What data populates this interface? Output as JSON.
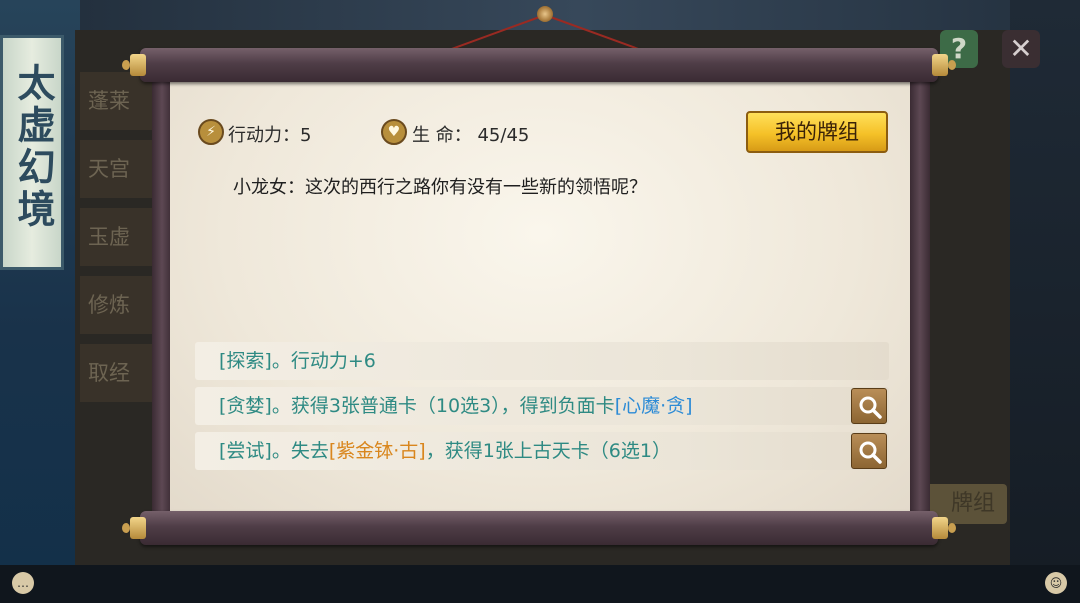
{
  "background": {
    "banner_title": "太虚幻境",
    "side_items": [
      "蓬莱",
      "天宫",
      "玉虚",
      "修炼",
      "取经"
    ],
    "help_label": "?",
    "close_label": "✕",
    "deck_button_label": "牌组"
  },
  "status": {
    "action_label": "行动力：",
    "action_value": "5",
    "life_label": "生 命：",
    "life_value": "45/45"
  },
  "deck_button": "我的牌组",
  "dialogue": "小龙女：这次的西行之路你有没有一些新的领悟呢？",
  "options": [
    {
      "parts": [
        "[探索]。行动力+6"
      ]
    },
    {
      "parts": [
        "[贪婪]。获得3张普通卡（10选3），得到负面卡",
        "[心魔·贪]"
      ]
    },
    {
      "parts": [
        "[尝试]。失去",
        "[紫金钵·古]",
        "，获得1张上古天卡（6选1）"
      ]
    }
  ],
  "icons": {
    "action": "lightning-icon",
    "life": "heart-icon",
    "search": "magnifier-icon",
    "chat": "chat-icon",
    "friends": "friends-icon"
  },
  "colors": {
    "option_text": "#2e8a83",
    "negative_card": "#2c8bd6",
    "item_highlight": "#d9861d",
    "deck_button": "#f5c128"
  }
}
